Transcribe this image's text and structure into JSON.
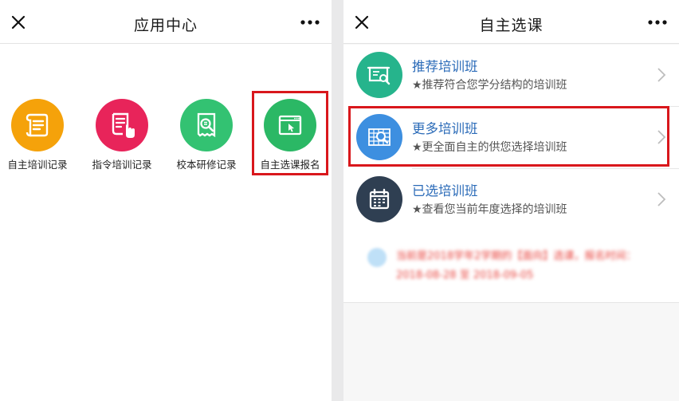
{
  "left_screen": {
    "title": "应用中心",
    "apps": [
      {
        "label": "自主培训记录",
        "color": "#f5a20a"
      },
      {
        "label": "指令培训记录",
        "color": "#e8245a"
      },
      {
        "label": "校本研修记录",
        "color": "#33c272"
      },
      {
        "label": "自主选课报名",
        "color": "#2bb865"
      }
    ]
  },
  "right_screen": {
    "title": "自主选课",
    "items": [
      {
        "title": "推荐培训班",
        "subtitle": "★推荐符合您学分结构的培训班",
        "color": "#26b48c"
      },
      {
        "title": "更多培训班",
        "subtitle": "★更全面自主的供您选择培训班",
        "color": "#3d8fe0"
      },
      {
        "title": "已选培训班",
        "subtitle": "★查看您当前年度选择的培训班",
        "color": "#2f3f52"
      }
    ],
    "notice": "当前是2018学年2学期的【面向】选课，报名时间：2018-08-28 至 2018-09-05"
  },
  "colors": {
    "highlight": "#d9171c",
    "link_blue": "#2b6bb8"
  }
}
